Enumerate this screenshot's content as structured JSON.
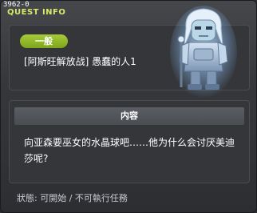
{
  "window": {
    "quest_id": "3962-0",
    "title": "QUEST INFO"
  },
  "quest": {
    "category": "一般",
    "name": "[阿斯旺解放战] 愚蠢的人1",
    "npc_portrait": "ghost-knight-npc"
  },
  "content": {
    "header": "内容",
    "body": "向亚森要巫女的水晶球吧……他为什么会讨厌美迪莎呢?"
  },
  "status": {
    "text": "狀態: 可開始 / 不可執行任務"
  },
  "colors": {
    "title": "#d8e86a",
    "badge": "#8fb82a",
    "panel": "#34363a"
  }
}
